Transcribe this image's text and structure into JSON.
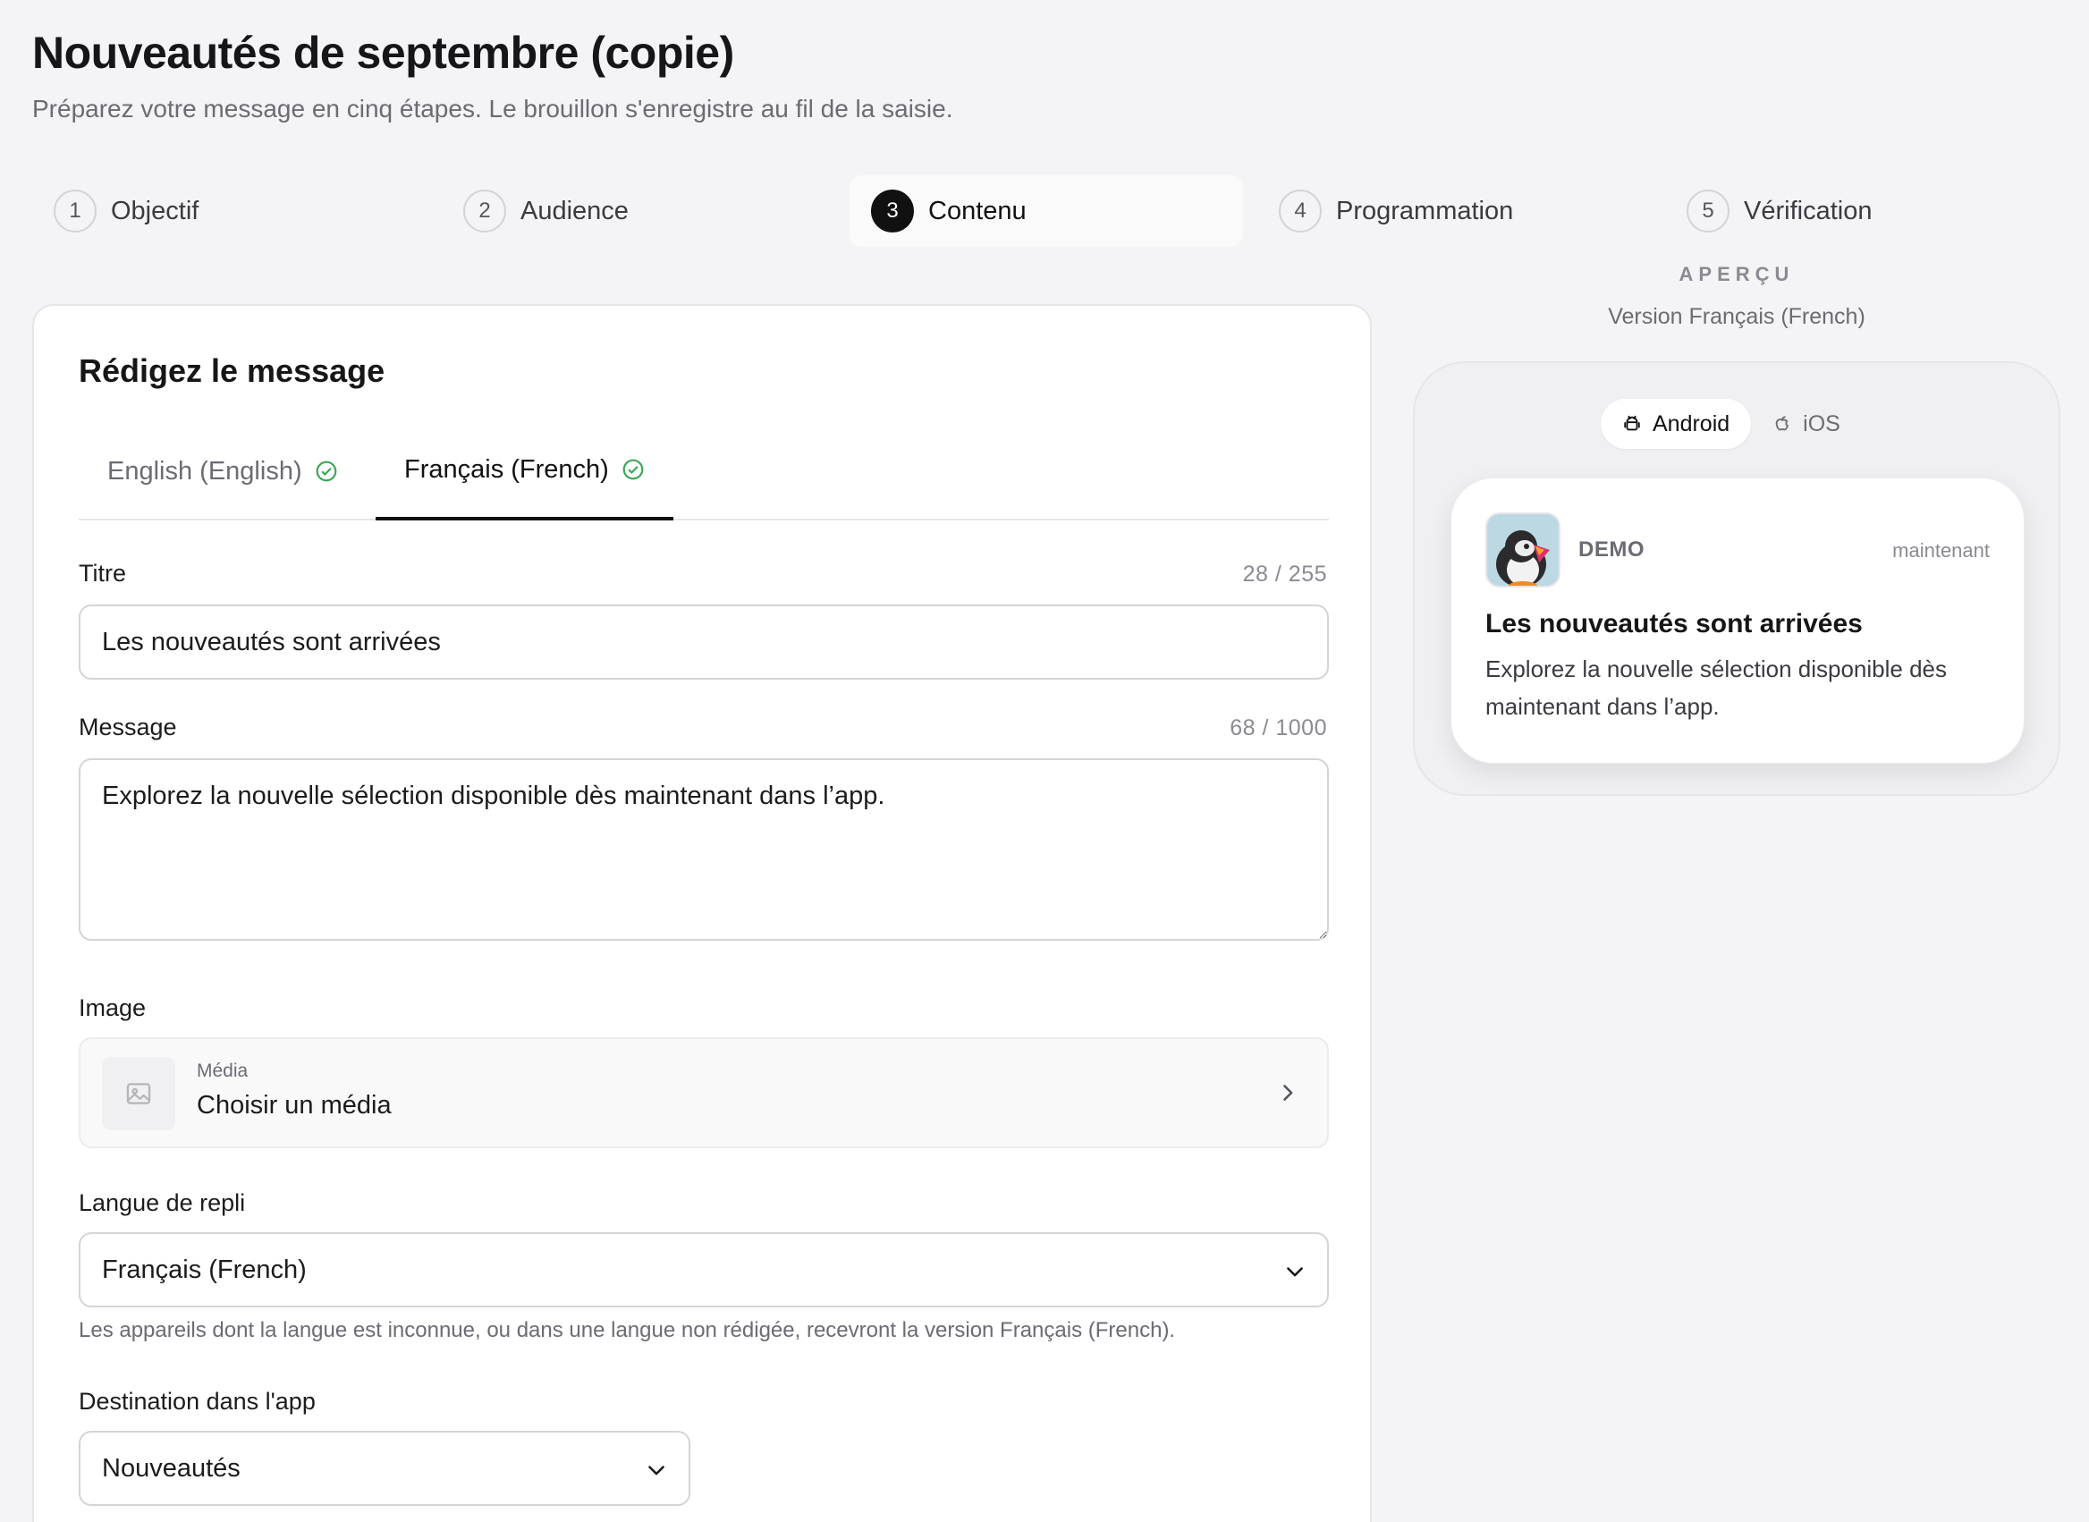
{
  "header": {
    "title": "Nouveautés de septembre (copie)",
    "subtitle": "Préparez votre message en cinq étapes. Le brouillon s'enregistre au fil de la saisie."
  },
  "stepper": {
    "active_step": 3,
    "steps": [
      {
        "number": "1",
        "label": "Objectif"
      },
      {
        "number": "2",
        "label": "Audience"
      },
      {
        "number": "3",
        "label": "Contenu"
      },
      {
        "number": "4",
        "label": "Programmation"
      },
      {
        "number": "5",
        "label": "Vérification"
      }
    ]
  },
  "form": {
    "title": "Rédigez le message",
    "language_tabs": [
      {
        "label": "English (English)",
        "complete": true,
        "active": false
      },
      {
        "label": "Français (French)",
        "complete": true,
        "active": true
      }
    ],
    "title_field": {
      "label": "Titre",
      "counter": "28 / 255",
      "value": "Les nouveautés sont arrivées"
    },
    "message_field": {
      "label": "Message",
      "counter": "68 / 1000",
      "value": "Explorez la nouvelle sélection disponible dès maintenant dans l’app."
    },
    "image_field": {
      "label": "Image",
      "caption": "Média",
      "value": "Choisir un média"
    },
    "fallback_language": {
      "label": "Langue de repli",
      "value": "Français (French)",
      "help": "Les appareils dont la langue est inconnue, ou dans une langue non rédigée, recevront la version Français (French)."
    },
    "destination": {
      "label": "Destination dans l'app",
      "value": "Nouveautés"
    }
  },
  "preview": {
    "eyebrow": "APERÇU",
    "version": "Version Français (French)",
    "os_options": [
      {
        "label": "Android",
        "icon": "android-icon",
        "active": true
      },
      {
        "label": "iOS",
        "icon": "apple-icon",
        "active": false
      }
    ],
    "notification": {
      "app_name": "DEMO",
      "time": "maintenant",
      "title": "Les nouveautés sont arrivées",
      "body": "Explorez la nouvelle sélection disponible dès maintenant dans l’app."
    }
  },
  "colors": {
    "background": "#f4f4f6",
    "accent": "#111111",
    "success": "#3aa655",
    "border": "#d4d4d8"
  }
}
